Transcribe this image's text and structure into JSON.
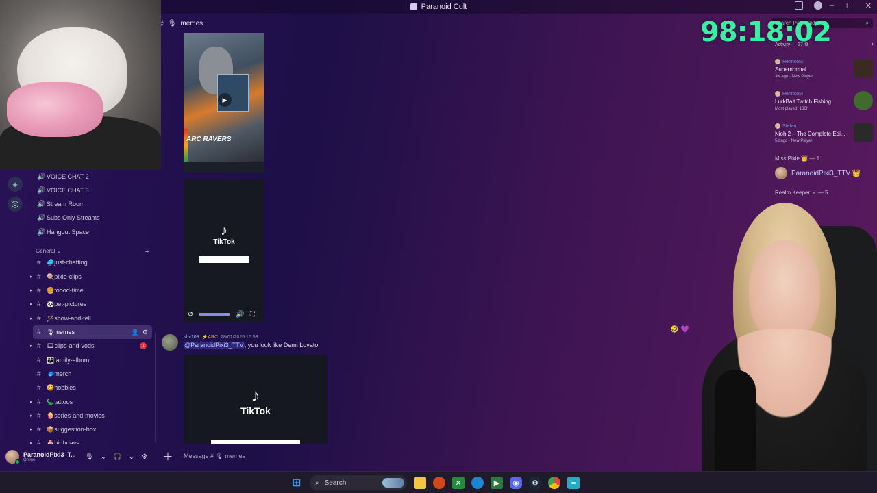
{
  "window": {
    "title": "Paranoid Cult"
  },
  "timer": "98:18:02",
  "channel_header": {
    "name": "memes"
  },
  "voice_channels": [
    "VOICE CHAT 2",
    "VOICE CHAT 3",
    "Stream Room",
    "Subs Only Streams",
    "Hangout Space"
  ],
  "category": {
    "name": "General"
  },
  "text_channels": [
    {
      "emoji": "🥏",
      "name": "just-chatting"
    },
    {
      "emoji": "🍭",
      "name": "pixie-clips"
    },
    {
      "emoji": "🍔",
      "name": "foood-time"
    },
    {
      "emoji": "🐼",
      "name": "pet-pictures"
    },
    {
      "emoji": "🪄",
      "name": "show-and-tell"
    },
    {
      "emoji": "🎙",
      "name": "memes"
    },
    {
      "emoji": "🎞",
      "name": "clips-and-vods"
    },
    {
      "emoji": "👪",
      "name": "family-album"
    },
    {
      "emoji": "🧢",
      "name": "merch"
    },
    {
      "emoji": "😋",
      "name": "hobbies"
    },
    {
      "emoji": "🦕",
      "name": "tattoos"
    },
    {
      "emoji": "🍿",
      "name": "series-and-movies"
    },
    {
      "emoji": "📦",
      "name": "suggestion-box"
    },
    {
      "emoji": "🎂",
      "name": "birthdays"
    }
  ],
  "unread_count": "1",
  "media": {
    "arc_raiders_label": "ARC RAVERS",
    "tiktok_label": "TikTok"
  },
  "message": {
    "author": "shv108",
    "tag": "ARC",
    "timestamp": "28/01/2026 15:53",
    "mention": "@ParanoidPixi3_TTV",
    "text": ", you look like Demi Lovato"
  },
  "composer": {
    "placeholder": "Message # 🎙 memes"
  },
  "user": {
    "name": "ParanoidPixi3_T...",
    "status": "Online"
  },
  "activity": {
    "search_placeholder": "Search Paranoid Cult",
    "header": "Activity — 27",
    "cards": [
      {
        "who": "HenricoM",
        "game": "Supernormal",
        "info": "3w ago · New Player",
        "thumb_color": "#3a2a22"
      },
      {
        "who": "HenricoM",
        "game": "LurkBait Twitch Fishing",
        "info": "Most played: 166h",
        "thumb_color": "#3f6b2e"
      },
      {
        "who": "Stefan",
        "game": "Nioh 2 – The Complete Edi...",
        "info": "5d ago · New Player",
        "thumb_color": "#2a2a2a"
      }
    ],
    "group1": "Miss Pixie 👑 — 1",
    "member1": "ParanoidPixi3_TTV 👑",
    "group2": "Realm Keeper ⚔ — 5"
  },
  "taskbar": {
    "search_label": "Search"
  }
}
